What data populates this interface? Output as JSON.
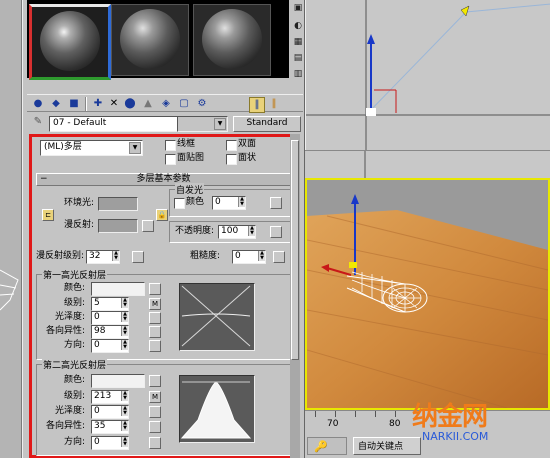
{
  "material_editor": {
    "toolbar": {
      "material_name": "07 - Default",
      "material_type": "Standard"
    },
    "shader": {
      "type": "(ML)多层",
      "wire_label": "线框",
      "two_sided_label": "双面",
      "face_map_label": "面贴图",
      "faceted_label": "面状"
    },
    "basic_params": {
      "title": "多层基本参数",
      "ambient_label": "环境光:",
      "diffuse_label": "漫反射:",
      "self_illum_group": "自发光",
      "color_label": "颜色",
      "self_illum_value": "0",
      "opacity_label": "不透明度:",
      "opacity_value": "100",
      "diffuse_level_label": "漫反射级别:",
      "diffuse_level_value": "32",
      "roughness_label": "粗糙度:",
      "roughness_value": "0"
    },
    "first_specular": {
      "title": "第一高光反射层",
      "color_label": "颜色:",
      "level_label": "级别:",
      "level_value": "5",
      "glossiness_label": "光泽度:",
      "glossiness_value": "0",
      "anisotropy_label": "各向异性:",
      "anisotropy_value": "98",
      "orientation_label": "方向:",
      "orientation_value": "0"
    },
    "second_specular": {
      "title": "第二高光反射层",
      "color_label": "颜色:",
      "level_label": "级别:",
      "level_value": "213",
      "glossiness_label": "光泽度:",
      "glossiness_value": "0",
      "anisotropy_label": "各向异性:",
      "anisotropy_value": "35",
      "orientation_label": "方向:",
      "orientation_value": "0"
    },
    "map_button_label": "M"
  },
  "timeline": {
    "frame_label": "70",
    "tick_label": "80",
    "autokey_label": "自动关键点"
  },
  "watermark": {
    "text": "纳金网",
    "domain": "NARKII.COM"
  },
  "colors": {
    "highlight_red": "#e01818",
    "viewport_active": "#e8e800",
    "wood": "#d8954a"
  }
}
